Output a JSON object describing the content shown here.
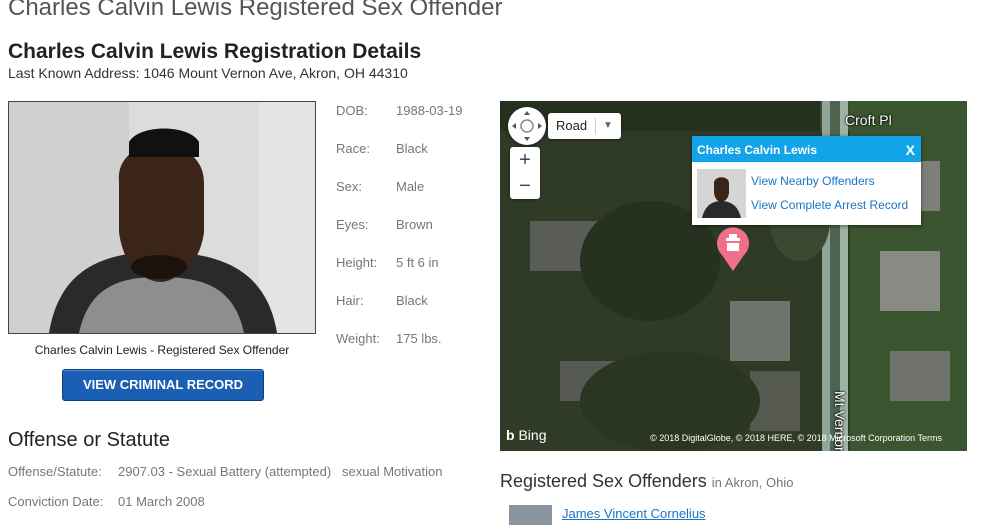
{
  "page": {
    "title": "Charles Calvin Lewis Registered Sex Offender",
    "section_title": "Charles Calvin Lewis Registration Details",
    "address": "Last Known Address: 1046 Mount Vernon Ave, Akron, OH 44310"
  },
  "profile": {
    "caption": "Charles Calvin Lewis - Registered Sex Offender",
    "button_label": "VIEW CRIMINAL RECORD",
    "details": [
      {
        "label": "DOB:",
        "value": "1988-03-19"
      },
      {
        "label": "Race:",
        "value": "Black"
      },
      {
        "label": "Sex:",
        "value": "Male"
      },
      {
        "label": "Eyes:",
        "value": "Brown"
      },
      {
        "label": "Height:",
        "value": "5 ft 6 in"
      },
      {
        "label": "Hair:",
        "value": "Black"
      },
      {
        "label": "Weight:",
        "value": "175 lbs."
      }
    ]
  },
  "offense": {
    "heading": "Offense or Statute",
    "statute_label": "Offense/Statute:",
    "statute_value": "2907.03 - Sexual Battery (attempted)   sexual Motivation",
    "conviction_label": "Conviction Date:",
    "conviction_value": "01 March 2008"
  },
  "map": {
    "map_type": "Road",
    "zoom_in": "+",
    "zoom_out": "−",
    "street_1": "Croft Pl",
    "street_2": "Mt Vernon",
    "info_title": "Charles Calvin Lewis",
    "info_close": "X",
    "link_nearby": "View Nearby Offenders",
    "link_arrest": "View Complete Arrest Record",
    "bing": "Bing",
    "copyright": "© 2018 DigitalGlobe, © 2018 HERE, © 2018 Microsoft Corporation  Terms"
  },
  "offenders": {
    "heading": "Registered Sex Offenders",
    "location": "in Akron, Ohio",
    "first_name": "James Vincent Cornelius"
  }
}
